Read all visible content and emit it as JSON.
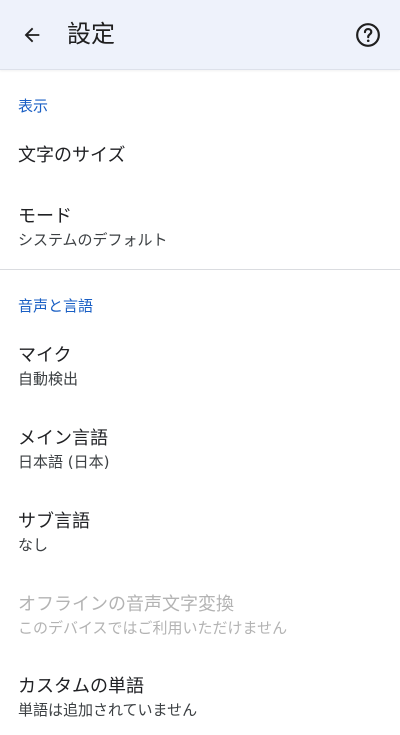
{
  "appbar": {
    "title": "設定",
    "back_icon": "arrow-back-icon",
    "help_icon": "help-circle-icon"
  },
  "sections": {
    "display": {
      "header": "表示",
      "items": [
        {
          "primary": "文字のサイズ"
        },
        {
          "primary": "モード",
          "secondary": "システムのデフォルト"
        }
      ]
    },
    "voice": {
      "header": "音声と言語",
      "items": [
        {
          "primary": "マイク",
          "secondary": "自動検出"
        },
        {
          "primary": "メイン言語",
          "secondary": "日本語 (日本)"
        },
        {
          "primary": "サブ言語",
          "secondary": "なし"
        },
        {
          "primary": "オフラインの音声文字変換",
          "secondary": "このデバイスではご利用いただけません",
          "disabled": true
        },
        {
          "primary": "カスタムの単語",
          "secondary": "単語は追加されていません"
        }
      ]
    }
  },
  "colors": {
    "appbar_bg": "#eef2fb",
    "accent": "#1a5fc4",
    "disabled_text": "#b3b3b3"
  }
}
